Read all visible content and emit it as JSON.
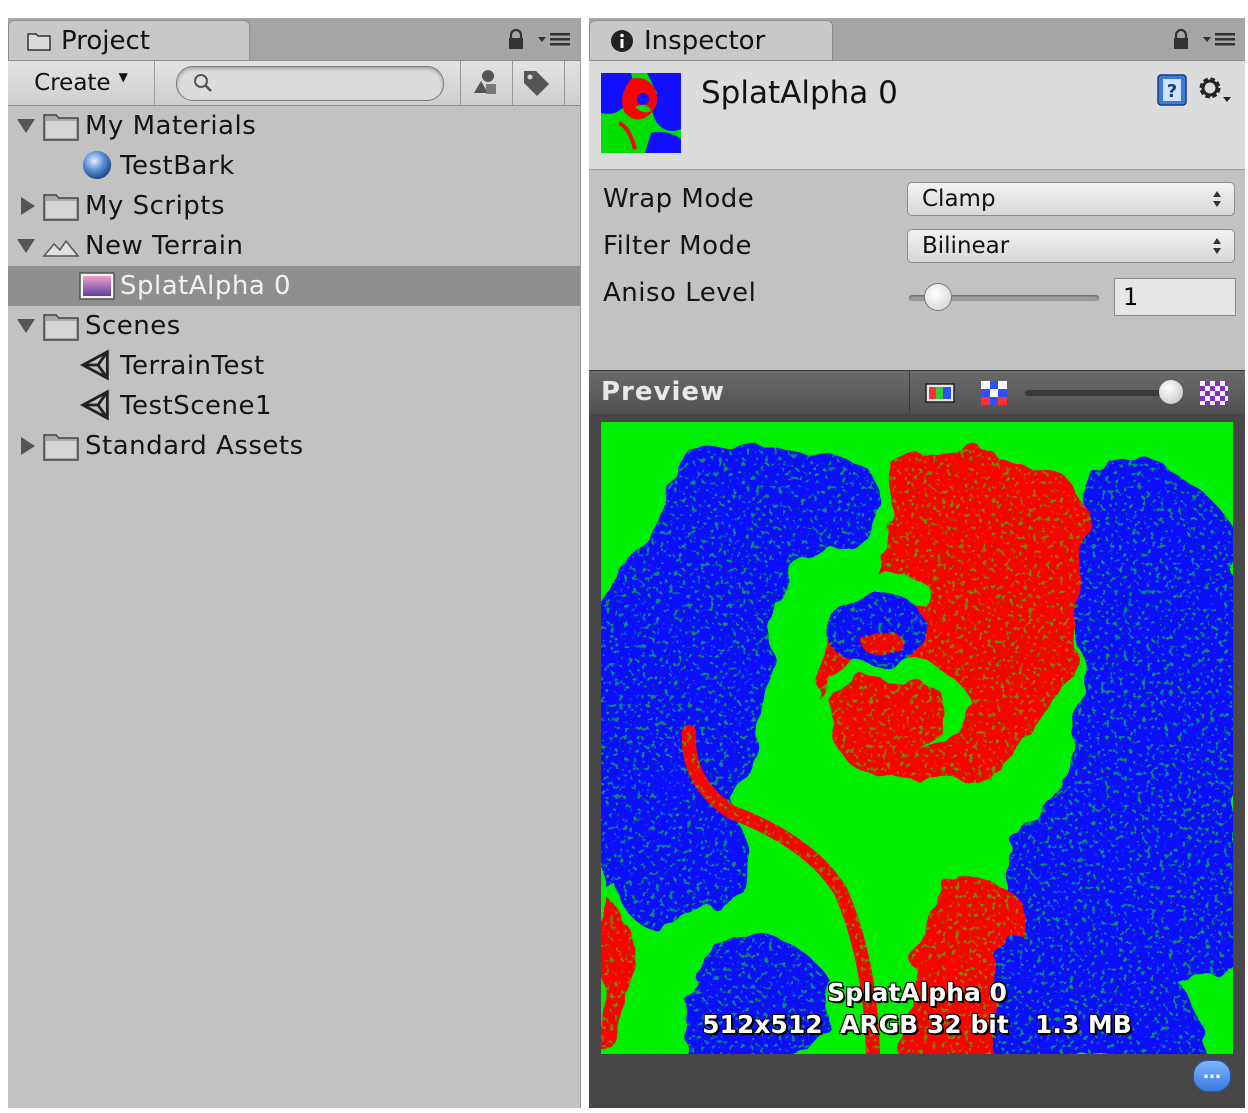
{
  "project": {
    "tab_label": "Project",
    "create_label": "Create",
    "search_placeholder": "",
    "tree": [
      {
        "label": "My Materials",
        "type": "folder",
        "expanded": true
      },
      {
        "label": "TestBark",
        "type": "material"
      },
      {
        "label": "My Scripts",
        "type": "folder",
        "expanded": false
      },
      {
        "label": "New Terrain",
        "type": "terrain",
        "expanded": true
      },
      {
        "label": "SplatAlpha 0",
        "type": "texture",
        "selected": true
      },
      {
        "label": "Scenes",
        "type": "folder",
        "expanded": true
      },
      {
        "label": "TerrainTest",
        "type": "scene"
      },
      {
        "label": "TestScene1",
        "type": "scene"
      },
      {
        "label": "Standard Assets",
        "type": "folder",
        "expanded": false
      }
    ]
  },
  "inspector": {
    "tab_label": "Inspector",
    "asset_title": "SplatAlpha 0",
    "wrap_mode_label": "Wrap Mode",
    "wrap_mode_value": "Clamp",
    "filter_mode_label": "Filter Mode",
    "filter_mode_value": "Bilinear",
    "aniso_level_label": "Aniso Level",
    "aniso_level_value": "1",
    "preview_label": "Preview",
    "preview_name": "SplatAlpha 0",
    "preview_info": "512x512  ARGB 32 bit   1.3 MB"
  },
  "colors": {
    "panel_bg": "#c2c2c2",
    "selected_row": "#8f8f8f",
    "splat_red": "#ff0000",
    "splat_green": "#00ee00",
    "splat_blue": "#1010ff"
  }
}
